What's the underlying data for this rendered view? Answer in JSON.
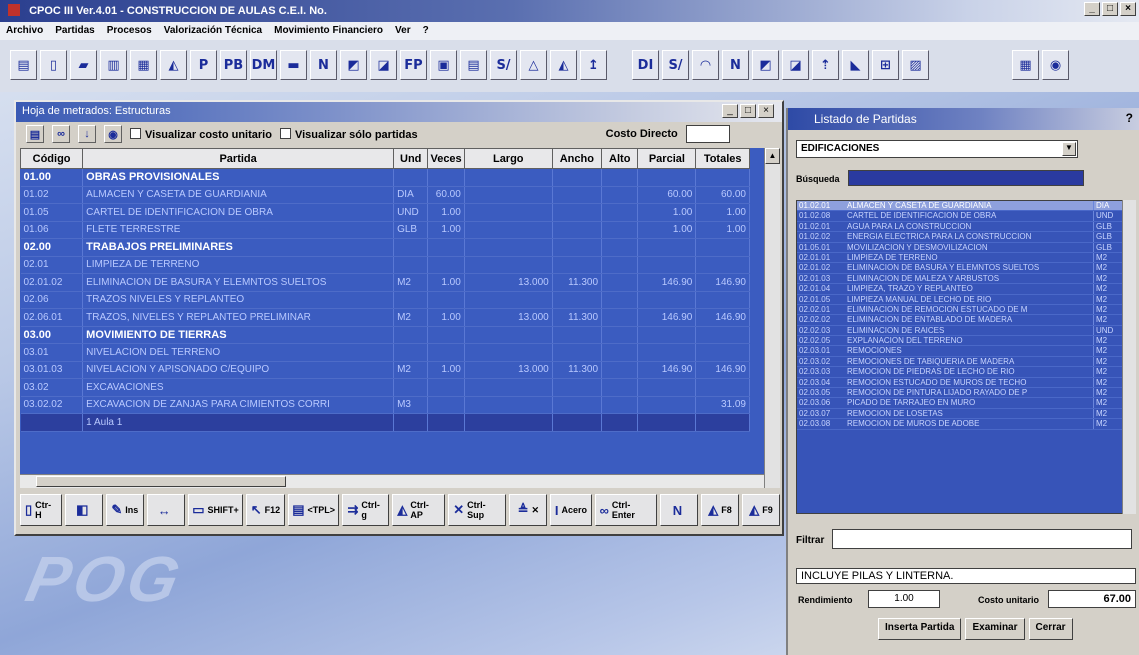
{
  "app": {
    "title": "CPOC III Ver.4.01 - CONSTRUCCION DE AULAS C.E.I. No.",
    "win_min": "_",
    "win_max": "□",
    "win_close": "×"
  },
  "menu": [
    "Archivo",
    "Partidas",
    "Procesos",
    "Valorización Técnica",
    "Movimiento Financiero",
    "Ver",
    "?"
  ],
  "toolbar": {
    "group1": [
      "▤",
      "▯",
      "▰",
      "▥",
      "▦",
      "◭",
      "P",
      "PB",
      "DM",
      "▬",
      "N",
      "◩",
      "◪",
      "FP",
      "▣",
      "▤",
      "S/",
      "△",
      "◭",
      "↥"
    ],
    "group2": [
      "DI",
      "S/",
      "◠",
      "N",
      "◩",
      "◪",
      "⇡",
      "◣",
      "⊞",
      "▨"
    ],
    "group3": [
      "▦",
      "◉"
    ]
  },
  "hoja": {
    "title": "Hoja de metrados: Estructuras",
    "visualizar_costo": "Visualizar costo unitario",
    "visualizar_partidas": "Visualizar sólo partidas",
    "costo_directo": "Costo Directo",
    "columns": [
      "Código",
      "Partida",
      "Und",
      "Veces",
      "Largo",
      "Ancho",
      "Alto",
      "Parcial",
      "Totales"
    ],
    "rows": [
      {
        "codigo": "01.00",
        "partida": "OBRAS PROVISIONALES",
        "und": "",
        "veces": "",
        "largo": "",
        "ancho": "",
        "alto": "",
        "parcial": "",
        "totales": "",
        "hdr": true
      },
      {
        "codigo": "01.02",
        "partida": "ALMACEN Y CASETA DE GUARDIANIA",
        "und": "DIA",
        "veces": "60.00",
        "largo": "",
        "ancho": "",
        "alto": "",
        "parcial": "60.00",
        "totales": "60.00"
      },
      {
        "codigo": "01.05",
        "partida": "CARTEL DE IDENTIFICACION DE OBRA",
        "und": "UND",
        "veces": "1.00",
        "largo": "",
        "ancho": "",
        "alto": "",
        "parcial": "1.00",
        "totales": "1.00"
      },
      {
        "codigo": "01.06",
        "partida": "FLETE TERRESTRE",
        "und": "GLB",
        "veces": "1.00",
        "largo": "",
        "ancho": "",
        "alto": "",
        "parcial": "1.00",
        "totales": "1.00"
      },
      {
        "codigo": "02.00",
        "partida": "TRABAJOS PRELIMINARES",
        "und": "",
        "veces": "",
        "largo": "",
        "ancho": "",
        "alto": "",
        "parcial": "",
        "totales": "",
        "hdr": true
      },
      {
        "codigo": "02.01",
        "partida": "LIMPIEZA DE TERRENO",
        "und": "",
        "veces": "",
        "largo": "",
        "ancho": "",
        "alto": "",
        "parcial": "",
        "totales": ""
      },
      {
        "codigo": "02.01.02",
        "partida": "ELIMINACION DE BASURA Y ELEMNTOS SUELTOS",
        "und": "M2",
        "veces": "1.00",
        "largo": "13.000",
        "ancho": "11.300",
        "alto": "",
        "parcial": "146.90",
        "totales": "146.90"
      },
      {
        "codigo": "02.06",
        "partida": "TRAZOS NIVELES Y REPLANTEO",
        "und": "",
        "veces": "",
        "largo": "",
        "ancho": "",
        "alto": "",
        "parcial": "",
        "totales": ""
      },
      {
        "codigo": "02.06.01",
        "partida": "TRAZOS, NIVELES Y REPLANTEO PRELIMINAR",
        "und": "M2",
        "veces": "1.00",
        "largo": "13.000",
        "ancho": "11.300",
        "alto": "",
        "parcial": "146.90",
        "totales": "146.90"
      },
      {
        "codigo": "03.00",
        "partida": "MOVIMIENTO DE TIERRAS",
        "und": "",
        "veces": "",
        "largo": "",
        "ancho": "",
        "alto": "",
        "parcial": "",
        "totales": "",
        "hdr": true
      },
      {
        "codigo": "03.01",
        "partida": "NIVELACION DEL TERRENO",
        "und": "",
        "veces": "",
        "largo": "",
        "ancho": "",
        "alto": "",
        "parcial": "",
        "totales": ""
      },
      {
        "codigo": "03.01.03",
        "partida": "NIVELACION Y APISONADO C/EQUIPO",
        "und": "M2",
        "veces": "1.00",
        "largo": "13.000",
        "ancho": "11.300",
        "alto": "",
        "parcial": "146.90",
        "totales": "146.90"
      },
      {
        "codigo": "03.02",
        "partida": "EXCAVACIONES",
        "und": "",
        "veces": "",
        "largo": "",
        "ancho": "",
        "alto": "",
        "parcial": "",
        "totales": ""
      },
      {
        "codigo": "03.02.02",
        "partida": "EXCAVACION DE ZANJAS PARA CIMIENTOS CORRI",
        "und": "M3",
        "veces": "",
        "largo": "",
        "ancho": "",
        "alto": "",
        "parcial": "",
        "totales": "31.09"
      },
      {
        "codigo": "",
        "partida": "1 Aula 1",
        "und": "",
        "veces": "",
        "largo": "",
        "ancho": "",
        "alto": "",
        "parcial": "",
        "totales": "",
        "sel": true
      }
    ],
    "bottom_tools": [
      {
        "icon": "▯",
        "label": "Ctr-H"
      },
      {
        "icon": "◧",
        "label": ""
      },
      {
        "icon": "✎",
        "label": "Ins"
      },
      {
        "icon": "↔",
        "label": ""
      },
      {
        "icon": "▭",
        "label": "SHIFT+"
      },
      {
        "icon": "↖",
        "label": "F12"
      },
      {
        "icon": "▤",
        "label": "<TPL>"
      },
      {
        "icon": "⇉",
        "label": "Ctrl-g"
      },
      {
        "icon": "◭",
        "label": "Ctrl-AP"
      },
      {
        "icon": "✕",
        "label": "Ctrl-Sup"
      },
      {
        "icon": "≜",
        "label": "✕"
      },
      {
        "icon": "I",
        "label": "Acero"
      },
      {
        "icon": "∞",
        "label": "Ctrl-Enter"
      },
      {
        "icon": "N",
        "label": ""
      },
      {
        "icon": "◭",
        "label": "F8"
      },
      {
        "icon": "◭",
        "label": "F9"
      }
    ]
  },
  "listado": {
    "title": "Listado de Partidas",
    "help": "?",
    "combo_value": "EDIFICACIONES",
    "busqueda_label": "Búsqueda",
    "items": [
      {
        "c": "01.02.01",
        "d": "ALMACEN Y CASETA DE GUARDIANIA",
        "u": "DIA",
        "sel": true
      },
      {
        "c": "01.02.08",
        "d": "CARTEL DE IDENTIFICACION DE OBRA",
        "u": "UND"
      },
      {
        "c": "01.02.01",
        "d": "AGUA PARA LA CONSTRUCCION",
        "u": "GLB"
      },
      {
        "c": "01.02.02",
        "d": "ENERGIA ELECTRICA PARA LA CONSTRUCCION",
        "u": "GLB"
      },
      {
        "c": "01.05.01",
        "d": "MOVILIZACION Y DESMOVILIZACION",
        "u": "GLB"
      },
      {
        "c": "02.01.01",
        "d": "LIMPIEZA DE TERRENO",
        "u": "M2"
      },
      {
        "c": "02.01.02",
        "d": "ELIMINACION DE BASURA Y ELEMNTOS SUELTOS",
        "u": "M2"
      },
      {
        "c": "02.01.03",
        "d": "ELIMINACION DE MALEZA Y ARBUSTOS",
        "u": "M2"
      },
      {
        "c": "02.01.04",
        "d": "LIMPIEZA, TRAZO Y REPLANTEO",
        "u": "M2"
      },
      {
        "c": "02.01.05",
        "d": "LIMPIEZA MANUAL DE LECHO DE RIO",
        "u": "M2"
      },
      {
        "c": "02.02.01",
        "d": "ELIMINACION DE REMOCION ESTUCADO DE M",
        "u": "M2"
      },
      {
        "c": "02.02.02",
        "d": "ELIMINACION DE ENTABLADO DE MADERA",
        "u": "M2"
      },
      {
        "c": "02.02.03",
        "d": "ELIMINACION DE RAICES",
        "u": "UND"
      },
      {
        "c": "02.02.05",
        "d": "EXPLANACION DEL TERRENO",
        "u": "M2"
      },
      {
        "c": "02.03.01",
        "d": "REMOCIONES",
        "u": "M2"
      },
      {
        "c": "02.03.02",
        "d": "REMOCIONES DE TABIQUERIA DE MADERA",
        "u": "M2"
      },
      {
        "c": "02.03.03",
        "d": "REMOCION DE PIEDRAS DE LECHO DE RIO",
        "u": "M2"
      },
      {
        "c": "02.03.04",
        "d": "REMOCION ESTUCADO DE MUROS DE TECHO",
        "u": "M2"
      },
      {
        "c": "02.03.05",
        "d": "REMOCION DE PINTURA LIJADO RAYADO DE P",
        "u": "M2"
      },
      {
        "c": "02.03.06",
        "d": "PICADO DE TARRAJEO EN MURO",
        "u": "M2"
      },
      {
        "c": "02.03.07",
        "d": "REMOCION DE LOSETAS",
        "u": "M2"
      },
      {
        "c": "02.03.08",
        "d": "REMOCION DE MUROS DE ADOBE",
        "u": "M2"
      }
    ],
    "filtrar_label": "Filtrar",
    "descripcion": "INCLUYE PILAS Y LINTERNA.",
    "rendimiento_label": "Rendimiento",
    "rendimiento_value": "1.00",
    "costo_unitario_label": "Costo unitario",
    "costo_unitario_value": "67.00",
    "btn_inserta": "Inserta Partida",
    "btn_examinar": "Examinar",
    "btn_cerrar": "Cerrar"
  },
  "logo_text": "POG"
}
